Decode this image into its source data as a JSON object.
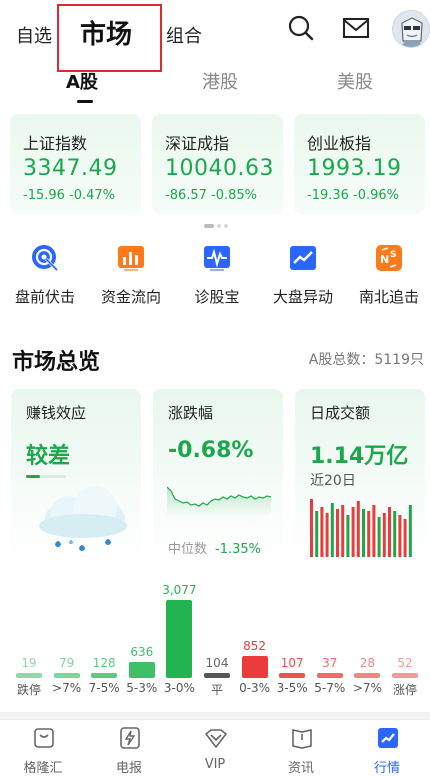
{
  "top_nav": {
    "tabs": [
      "自选",
      "市场",
      "组合"
    ],
    "active": "市场"
  },
  "market_tabs": {
    "items": [
      "A股",
      "港股",
      "美股"
    ],
    "active": "A股"
  },
  "indices": [
    {
      "name": "上证指数",
      "price": "3347.49",
      "change": "-15.96  -0.47%"
    },
    {
      "name": "深证成指",
      "price": "10040.63",
      "change": "-86.57  -0.85%"
    },
    {
      "name": "创业板指",
      "price": "1993.19",
      "change": "-19.36  -0.96%"
    }
  ],
  "features": [
    {
      "label": "盘前伏击",
      "icon": "target-icon"
    },
    {
      "label": "资金流向",
      "icon": "bar-chart-icon"
    },
    {
      "label": "诊股宝",
      "icon": "pulse-icon"
    },
    {
      "label": "大盘异动",
      "icon": "trend-line-icon"
    },
    {
      "label": "南北追击",
      "icon": "north-south-icon"
    }
  ],
  "overview": {
    "title": "市场总览",
    "stock_count": "A股总数：5119只",
    "cards": {
      "profit_effect": {
        "title": "赚钱效应",
        "value": "较差"
      },
      "change": {
        "title": "涨跌幅",
        "value": "-0.68%",
        "median_label": "中位数",
        "median_value": "-1.35%"
      },
      "turnover": {
        "title": "日成交额",
        "value": "1.14万亿",
        "sub": "近20日"
      }
    }
  },
  "distribution": [
    {
      "label": "跌停",
      "count": "19",
      "count_num": 19,
      "color": "#8fd9a7"
    },
    {
      "label": ">7%",
      "count": "79",
      "count_num": 79,
      "color": "#7ad69a"
    },
    {
      "label": "7-5%",
      "count": "128",
      "count_num": 128,
      "color": "#5ccb80"
    },
    {
      "label": "5-3%",
      "count": "636",
      "count_num": 636,
      "color": "#3fbf66"
    },
    {
      "label": "3-0%",
      "count": "3,077",
      "count_num": 3077,
      "color": "#21b451"
    },
    {
      "label": "平",
      "count": "104",
      "count_num": 104,
      "color": "#555555"
    },
    {
      "label": "0-3%",
      "count": "852",
      "count_num": 852,
      "color": "#ec3b3b"
    },
    {
      "label": "3-5%",
      "count": "107",
      "count_num": 107,
      "color": "#ef5151"
    },
    {
      "label": "5-7%",
      "count": "37",
      "count_num": 37,
      "color": "#f26a6a"
    },
    {
      "label": ">7%",
      "count": "28",
      "count_num": 28,
      "color": "#f48484"
    },
    {
      "label": "涨停",
      "count": "52",
      "count_num": 52,
      "color": "#f59a9a"
    }
  ],
  "tab_bar": [
    {
      "label": "格隆汇",
      "icon": "home-icon"
    },
    {
      "label": "电报",
      "icon": "flash-icon"
    },
    {
      "label": "VIP",
      "icon": "vip-icon"
    },
    {
      "label": "资讯",
      "icon": "news-icon"
    },
    {
      "label": "行情",
      "icon": "market-icon"
    }
  ],
  "tab_bar_active": "行情",
  "colors": {
    "up": "#ec3b3b",
    "down": "#1aa84b",
    "accent": "#2a66ff",
    "highlight": "#e0282e"
  }
}
